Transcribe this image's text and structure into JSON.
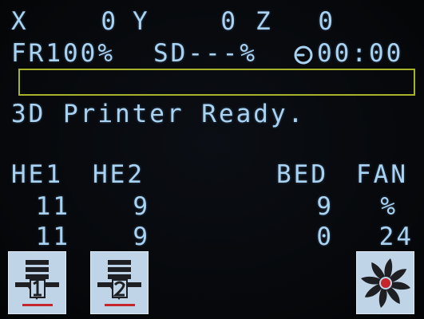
{
  "status_line1": {
    "x_label": "X",
    "x_value": "0",
    "y_label": "Y",
    "y_value": "0",
    "z_label": "Z",
    "z_value": "0"
  },
  "status_line2": {
    "feedrate": "FR100%",
    "sd": "SD---%",
    "clock_icon": "clock-icon",
    "time": "00:00"
  },
  "progress": {
    "fraction": 0
  },
  "message": "3D Printer Ready.",
  "table": {
    "headers": {
      "he1": "HE1",
      "he2": "HE2",
      "bed": "BED",
      "fan": "FAN"
    },
    "row_current": {
      "he1": "11",
      "he2": "9",
      "bed": "9",
      "fan": "%"
    },
    "row_target": {
      "he1": "11",
      "he2": "9",
      "bed": "0",
      "fan": "24"
    }
  },
  "buttons": [
    {
      "icon": "extruder-1-icon"
    },
    {
      "icon": "extruder-2-icon"
    },
    {
      "icon": "fan-icon"
    }
  ],
  "colors": {
    "text": "#a9d3f3",
    "progress_border": "#a8b12a",
    "button_bg": "#bfd4e6",
    "icon_dark": "#1d1f22",
    "icon_accent": "#c4262c"
  }
}
